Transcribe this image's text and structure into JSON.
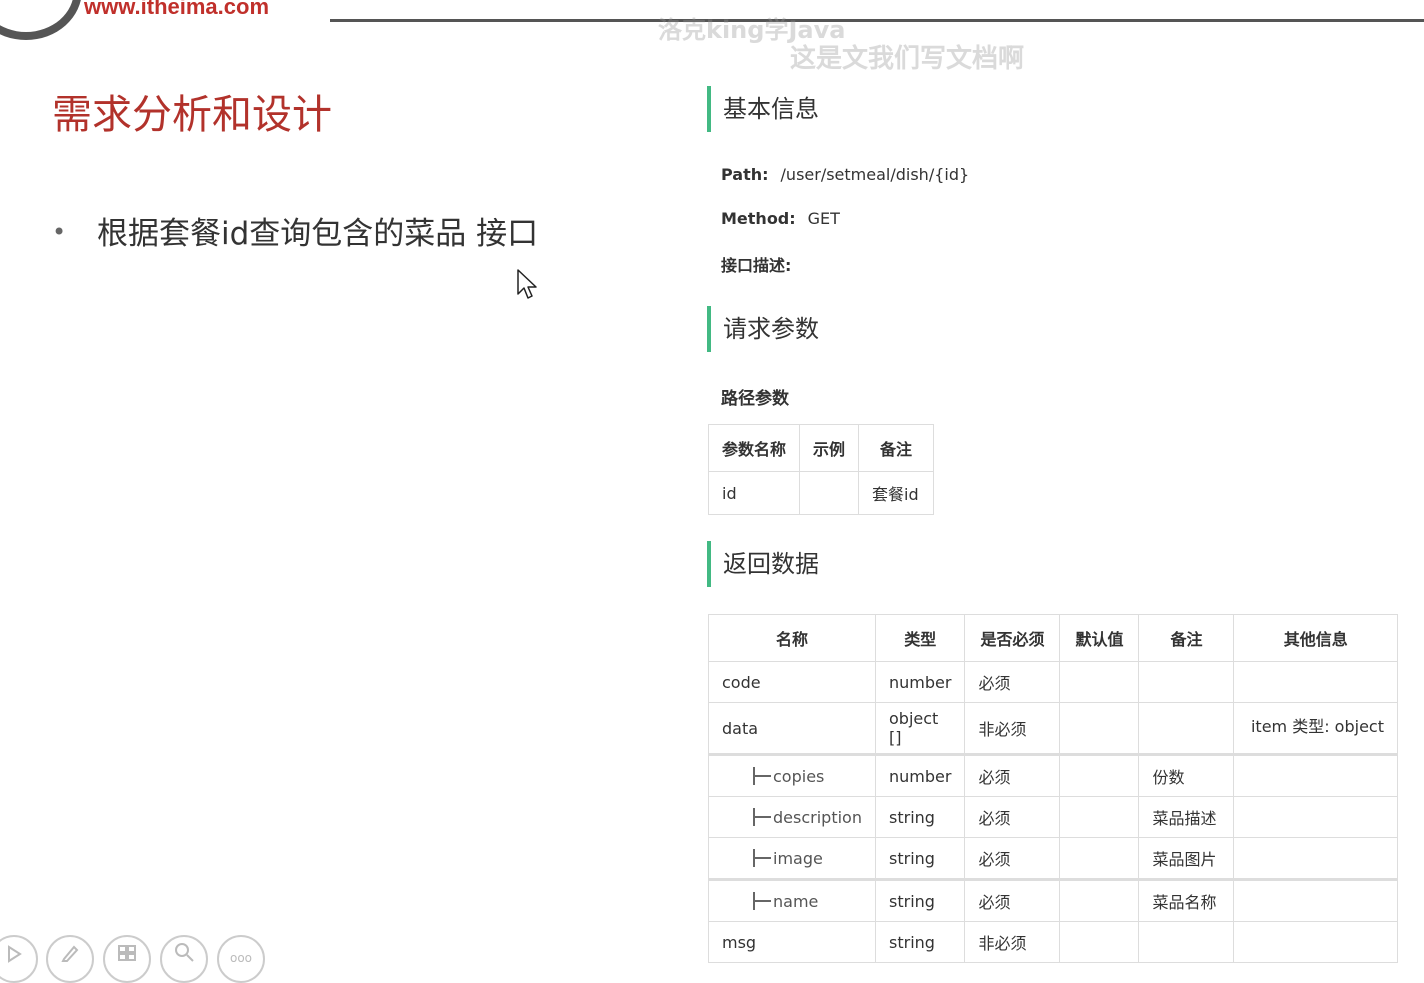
{
  "header": {
    "logo_url": "www.itheima.com",
    "watermarks": [
      "洛克king学Java",
      "这是文我们写文档啊"
    ]
  },
  "slide": {
    "title": "需求分析和设计",
    "bullet_mark": "•",
    "bullet": "根据套餐id查询包含的菜品 接口"
  },
  "doc": {
    "basic_info_title": "基本信息",
    "path_label": "Path:",
    "path_value": "/user/setmeal/dish/{id}",
    "method_label": "Method:",
    "method_value": "GET",
    "desc_label": "接口描述:",
    "request_title": "请求参数",
    "path_params_title": "路径参数",
    "path_params": {
      "headers": [
        "参数名称",
        "示例",
        "备注"
      ],
      "rows": [
        [
          "id",
          "",
          "套餐id"
        ]
      ]
    },
    "response_title": "返回数据",
    "response": {
      "headers": [
        "名称",
        "类型",
        "是否必须",
        "默认值",
        "备注",
        "其他信息"
      ],
      "rows": [
        {
          "name": "code",
          "type": "number",
          "required": "必须",
          "default": "",
          "note": "",
          "other": ""
        },
        {
          "name": "data",
          "type": "object []",
          "required": "非必须",
          "default": "",
          "note": "",
          "other": "item 类型: object"
        },
        {
          "name": "copies",
          "type": "number",
          "required": "必须",
          "default": "",
          "note": "份数",
          "other": ""
        },
        {
          "name": "description",
          "type": "string",
          "required": "必须",
          "default": "",
          "note": "菜品描述",
          "other": ""
        },
        {
          "name": "image",
          "type": "string",
          "required": "必须",
          "default": "",
          "note": "菜品图片",
          "other": ""
        },
        {
          "name": "name",
          "type": "string",
          "required": "必须",
          "default": "",
          "note": "菜品名称",
          "other": ""
        },
        {
          "name": "msg",
          "type": "string",
          "required": "非必须",
          "default": "",
          "note": "",
          "other": ""
        }
      ]
    }
  },
  "controls": {
    "icons": [
      "play-icon",
      "pen-icon",
      "slides-icon",
      "zoom-icon",
      "more-icon"
    ],
    "more_glyph": "ooo"
  }
}
